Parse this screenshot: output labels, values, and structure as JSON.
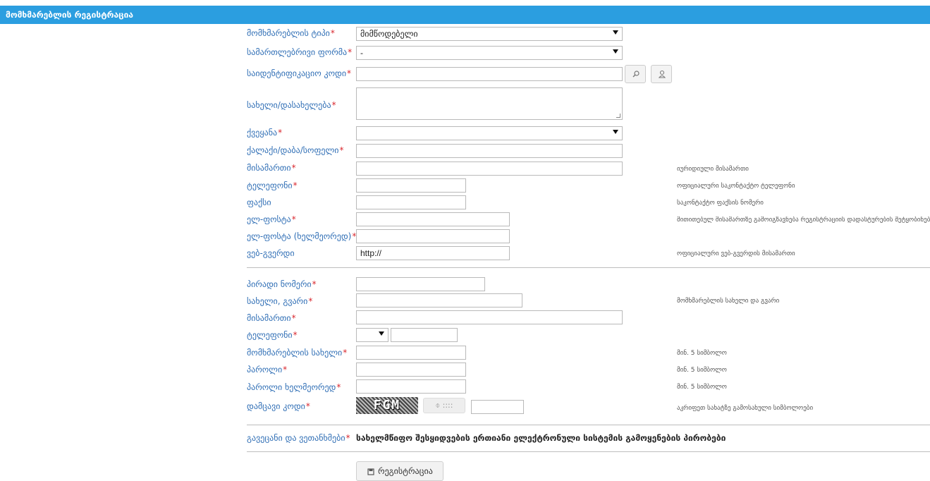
{
  "header": {
    "title": "მომხმარებლის რეგისტრაცია"
  },
  "fields": {
    "user_type": {
      "label": "მომხმარებლის ტიპი",
      "value": "მიმწოდებელი"
    },
    "legal_form": {
      "label": "სამართლებრივი ფორმა",
      "value": "-"
    },
    "id_code": {
      "label": "საიდენტიფიკაციო კოდი",
      "value": ""
    },
    "name": {
      "label": "სახელი/დასახელება",
      "value": ""
    },
    "country": {
      "label": "ქვეყანა",
      "value": ""
    },
    "city": {
      "label": "ქალაქი/დაბა/სოფელი",
      "value": ""
    },
    "address": {
      "label": "მისამართი",
      "value": "",
      "hint": "იურიდიული მისამართი"
    },
    "phone": {
      "label": "ტელეფონი",
      "value": "",
      "hint": "ოფიციალური საკონტაქტო ტელეფონი"
    },
    "fax": {
      "label": "ფაქსი",
      "value": "",
      "hint": "საკონტაქტო ფაქსის ნომერი"
    },
    "email": {
      "label": "ელ-ფოსტა",
      "value": "",
      "hint": "მითითებულ მისამართზე გამოიგზავნება რეგისტრაციის დადასტურების შეტყობინება"
    },
    "email_repeat": {
      "label": "ელ-ფოსტა (ხელმეორედ)",
      "value": ""
    },
    "website": {
      "label": "ვებ-გვერდი",
      "value": "http://",
      "hint": "ოფიციალური ვებ-გვერდის მისამართი"
    }
  },
  "personal": {
    "personal_number": {
      "label": "პირადი ნომერი",
      "value": ""
    },
    "full_name": {
      "label": "სახელი, გვარი",
      "value": "",
      "hint": "მომხმარებლის სახელი და გვარი"
    },
    "address": {
      "label": "მისამართი",
      "value": ""
    },
    "phone": {
      "label": "ტელეფონი",
      "code_value": "",
      "value": ""
    },
    "username": {
      "label": "მომხმარებლის სახელი",
      "value": "",
      "hint": "მინ. 5 სიმბოლო"
    },
    "password": {
      "label": "პაროლი",
      "value": "",
      "hint": "მინ. 5 სიმბოლო"
    },
    "password_repeat": {
      "label": "პაროლი ხელმეორედ",
      "value": "",
      "hint": "მინ. 5 სიმბოლო"
    },
    "captcha": {
      "label": "დამცავი კოდი",
      "image_text": "FGM",
      "refresh_label": "⌽ ::::",
      "value": "",
      "hint": "აკრიფეთ სახატზე გამოსახული სიმბოლოები"
    }
  },
  "terms": {
    "label": "გავეცანი და ვეთანხმები",
    "text": "სახელმწიფო შესყიდვების ერთიანი ელექტრონული სისტემის გამოყენების პირობები"
  },
  "submit": {
    "label": "რეგისტრაცია"
  },
  "required_mark": "*",
  "colors": {
    "header_bg": "#2b9ee0",
    "label": "#2f6eb5",
    "required": "#d9272e"
  }
}
